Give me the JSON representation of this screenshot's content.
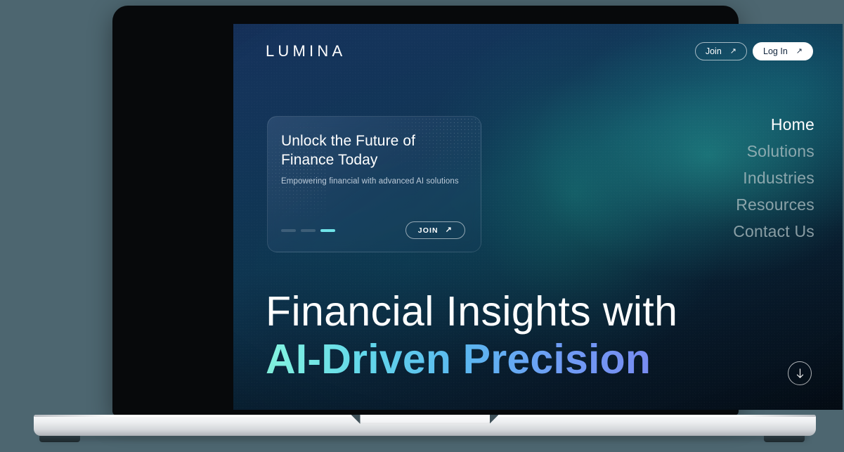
{
  "theme": {
    "page_background": "#4d6670",
    "screen_base": "#0c1b31",
    "accent_cyan": "#6fe3e8",
    "gradient_start": "#85f5e0",
    "gradient_end": "#7b87f0",
    "laptop_bezel": "#07090b",
    "laptop_base": "#eceef0"
  },
  "site": {
    "logo": "LUMINA"
  },
  "top_actions": [
    {
      "label": "Join",
      "icon": "arrow-up-right-icon",
      "style": "outline"
    },
    {
      "label": "Log In",
      "icon": "arrow-up-right-icon",
      "style": "solid"
    }
  ],
  "promo_card": {
    "title_line1": "Unlock the Future of",
    "title_line2": "Finance Today",
    "subtitle": "Empowering financial with advanced AI solutions",
    "cta": {
      "label": "JOIN",
      "icon": "arrow-up-right-icon"
    },
    "carousel": {
      "total": 3,
      "active_index": 2,
      "active_color": "#6fe3e8"
    }
  },
  "nav": {
    "items": [
      {
        "label": "Home",
        "active": true
      },
      {
        "label": "Solutions",
        "active": false
      },
      {
        "label": "Industries",
        "active": false
      },
      {
        "label": "Resources",
        "active": false
      },
      {
        "label": "Contact Us",
        "active": false
      }
    ]
  },
  "hero": {
    "line1": "Financial Insights with",
    "line2": "AI-Driven Precision"
  },
  "scroll_button": {
    "icon": "arrow-down-icon"
  }
}
